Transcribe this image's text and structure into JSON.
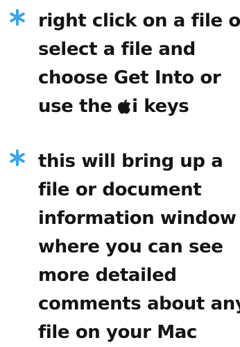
{
  "bullets": [
    {
      "lines": [
        "right click on a file or",
        "select a file and",
        "choose Get Into or",
        "use the ",
        "i keys"
      ]
    },
    {
      "lines": [
        "this will bring up a",
        "file or document",
        "information window",
        "where you can see",
        "more detailed",
        "comments about any",
        "file on your Mac"
      ]
    }
  ],
  "icons": {
    "bullet": "asterisk-icon",
    "modifier_key": "apple-logo-icon"
  },
  "colors": {
    "bullet": "#3aa6e6",
    "text": "#141414",
    "background": "#ffffff"
  }
}
